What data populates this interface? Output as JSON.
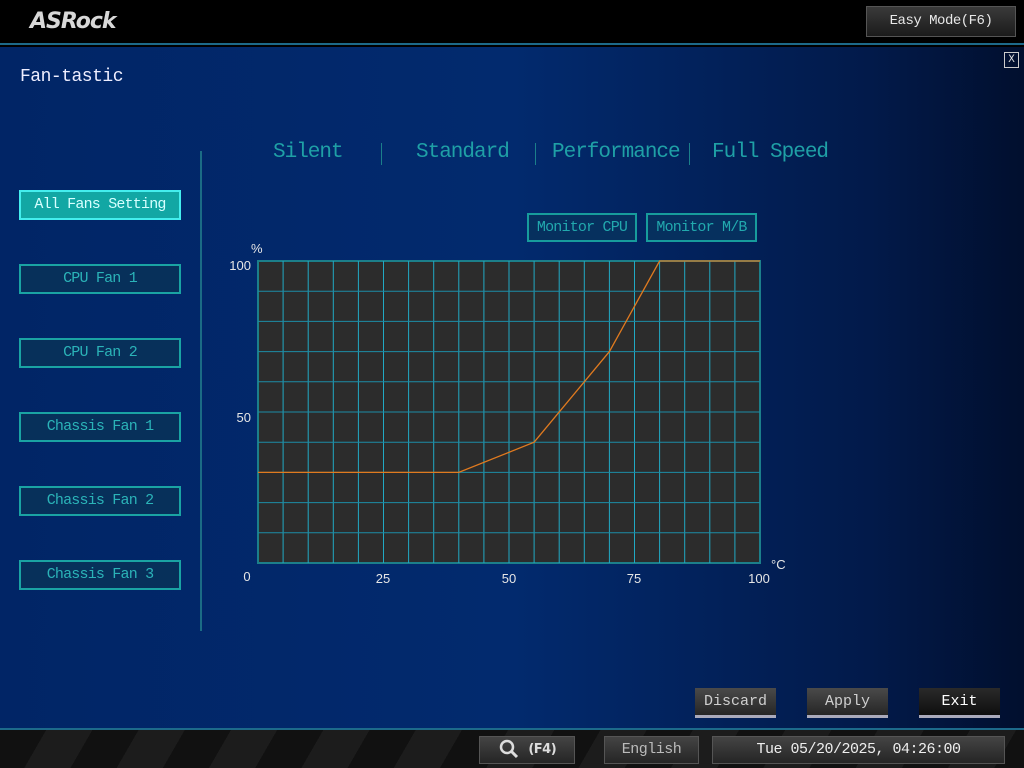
{
  "header": {
    "logo": "ASRock",
    "easy_mode": "Easy Mode(F6)"
  },
  "page": {
    "title": "Fan-tastic",
    "close": "X"
  },
  "fans": [
    {
      "label": "All Fans Setting",
      "active": true
    },
    {
      "label": "CPU Fan 1"
    },
    {
      "label": "CPU Fan 2"
    },
    {
      "label": "Chassis Fan 1"
    },
    {
      "label": "Chassis Fan 2"
    },
    {
      "label": "Chassis Fan 3"
    }
  ],
  "modes": [
    "Silent",
    "Standard",
    "Performance",
    "Full Speed"
  ],
  "monitor": {
    "cpu": "Monitor CPU",
    "mb": "Monitor M/B"
  },
  "chart_data": {
    "type": "line",
    "xlabel": "°C",
    "ylabel": "%",
    "xlim": [
      0,
      100
    ],
    "ylim": [
      0,
      100
    ],
    "xticks": [
      "0",
      "25",
      "50",
      "75",
      "100"
    ],
    "yticks": [
      "50",
      "100"
    ],
    "grid": true,
    "x": [
      0,
      40,
      55,
      70,
      80,
      100
    ],
    "y": [
      30,
      30,
      40,
      70,
      100,
      100
    ],
    "line_color": "#e07a1f"
  },
  "actions": {
    "discard": "Discard",
    "apply": "Apply",
    "exit": "Exit"
  },
  "footer": {
    "search": "(F4)",
    "language": "English",
    "datetime": "Tue 05/20/2025, 04:26:00"
  }
}
